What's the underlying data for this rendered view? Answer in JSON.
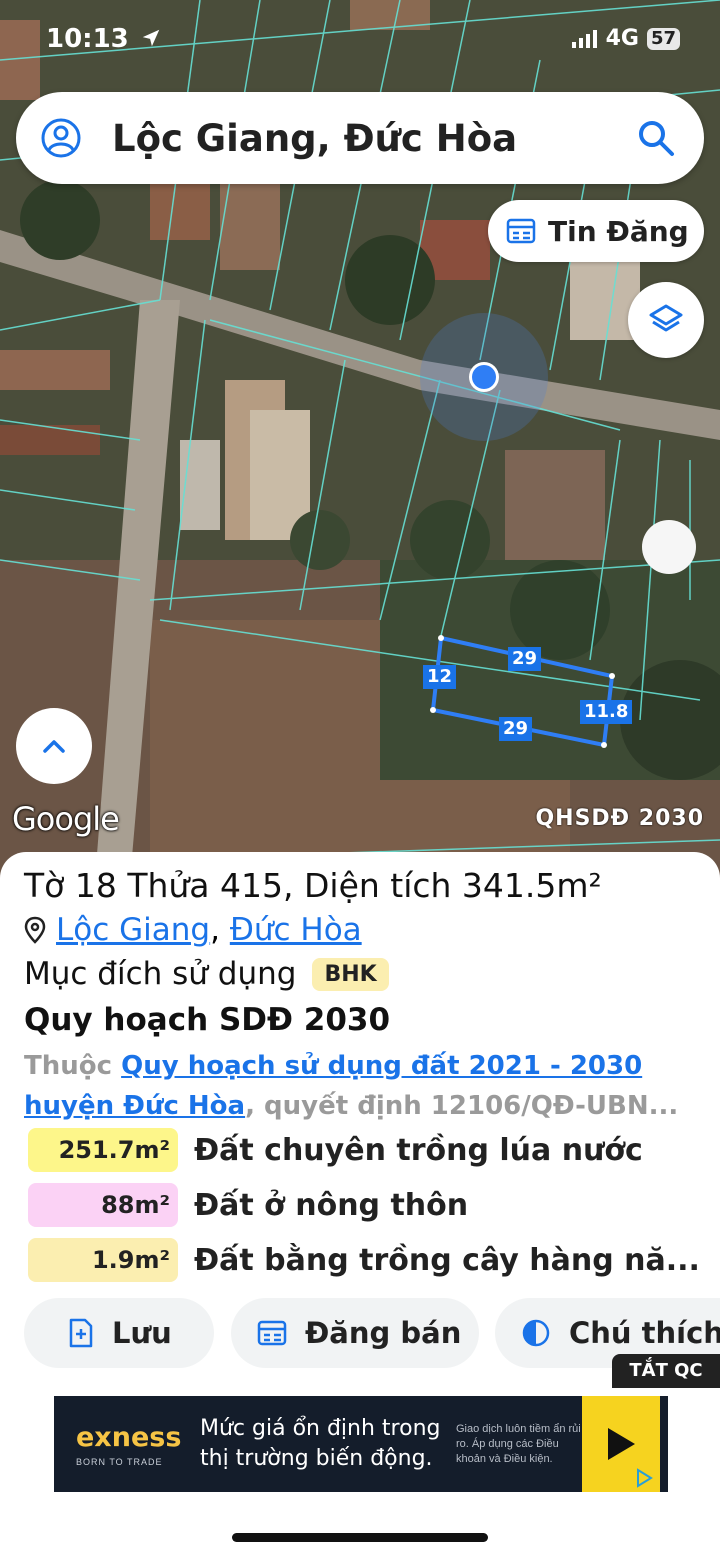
{
  "status_bar": {
    "time": "10:13",
    "network": "4G",
    "battery": "57"
  },
  "search": {
    "title": "Lộc Giang, Đức Hòa"
  },
  "map": {
    "tin_dang_label": "Tin Đăng",
    "google_label": "Google",
    "layer_label": "QHSDĐ 2030",
    "dimensions": {
      "top": "29",
      "left": "12",
      "bottom": "29",
      "right": "11.8"
    }
  },
  "parcel": {
    "title": "Tờ 18 Thửa 415, Diện tích 341.5m²",
    "commune": "Lộc Giang",
    "separator": ",",
    "district": "Đức Hòa",
    "purpose_label": "Mục đích sử dụng",
    "purpose_code": "BHK",
    "plan_title": "Quy hoạch SDĐ 2030",
    "belong_prefix": "Thuộc",
    "belong_link": "Quy hoạch sử dụng đất 2021 - 2030 huyện Đức Hòa",
    "belong_suffix": ", quyết định 12106/QĐ-UBN...",
    "land_uses": [
      {
        "area": "251.7m²",
        "name": "Đất chuyên trồng lúa nước",
        "color": "#fdf68a"
      },
      {
        "area": "88m²",
        "name": "Đất ở nông thôn",
        "color": "#fbd2f5"
      },
      {
        "area": "1.9m²",
        "name": "Đất bằng trồng cây hàng nă...",
        "color": "#fbeeb0"
      }
    ]
  },
  "actions": {
    "save": "Lưu",
    "sell": "Đăng bán",
    "legend": "Chú thích"
  },
  "ad": {
    "hide_label": "TẮT QC",
    "brand": "exness",
    "tagline": "BORN TO TRADE",
    "message": "Mức giá ổn định trong thị trường biến động.",
    "disclaimer": "Giao dịch luôn tiềm ẩn rủi ro. Áp dụng các Điều khoản và Điều kiện."
  },
  "colors": {
    "accent": "#1a73e8",
    "parcel_lines": "#66e0d4"
  }
}
